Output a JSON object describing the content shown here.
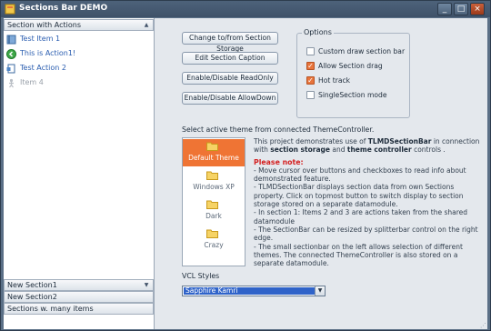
{
  "window": {
    "title": "Sections Bar DEMO",
    "minimize_glyph": "_",
    "maximize_glyph": "□",
    "close_glyph": "×"
  },
  "sidebar": {
    "top_section": {
      "label": "Section with Actions",
      "items": [
        {
          "label": "Test Item 1",
          "icon": "notebook-icon",
          "enabled": true
        },
        {
          "label": "This is Action1!",
          "icon": "green-circle-arrow-icon",
          "enabled": true
        },
        {
          "label": "Test Action 2",
          "icon": "document-icon",
          "enabled": true
        },
        {
          "label": "Item 4",
          "icon": "figure-icon",
          "enabled": false
        }
      ]
    },
    "bottom_sections": [
      {
        "label": "New Section1"
      },
      {
        "label": "New Section2"
      },
      {
        "label": "Sections w. many items"
      }
    ]
  },
  "buttons": [
    {
      "label": "Change to/from Section Storage"
    },
    {
      "label": "Edit Section Caption"
    },
    {
      "label": "Enable/Disable ReadOnly"
    },
    {
      "label": "Enable/Disable AllowDown"
    }
  ],
  "options": {
    "legend": "Options",
    "items": [
      {
        "label": "Custom draw section bar",
        "checked": false
      },
      {
        "label": "Allow Section drag",
        "checked": true
      },
      {
        "label": "Hot track",
        "checked": true
      },
      {
        "label": "SingleSection mode",
        "checked": false
      }
    ]
  },
  "themes": {
    "prompt": "Select active theme from connected ThemeController.",
    "items": [
      {
        "label": "Default Theme",
        "active": true
      },
      {
        "label": "Windows XP",
        "active": false
      },
      {
        "label": "Dark",
        "active": false
      },
      {
        "label": "Crazy",
        "active": false
      }
    ]
  },
  "description": {
    "intro_1": "This project demonstrates use of ",
    "component": "TLMDSectionBar",
    "intro_2": " in connection with ",
    "storage": "section storage",
    "intro_3": " and ",
    "controller": "theme controller",
    "intro_4": " controls .",
    "note_title": "Please note:",
    "notes": [
      "- Move cursor over buttons and checkboxes to read info about demonstrated feature.",
      "- TLMDSectionBar displays section data from own Sections property. Click on topmost button to switch display to section storage stored on a separate datamodule.",
      "- In section 1: Items 2 and 3 are actions taken from the shared datamodule",
      "- The SectionBar can be resized by splitterbar control on the right edge.",
      "- The small sectionbar on the left allows selection of different themes. The connected ThemeController is also stored on a separate datamodule."
    ]
  },
  "vcl_styles": {
    "label": "VCL Styles",
    "selected": "Sapphire Kamri"
  },
  "colors": {
    "accent": "#ef7434",
    "selection": "#2f63c9",
    "titlebar": "#4d627a",
    "note": "#d42020"
  }
}
